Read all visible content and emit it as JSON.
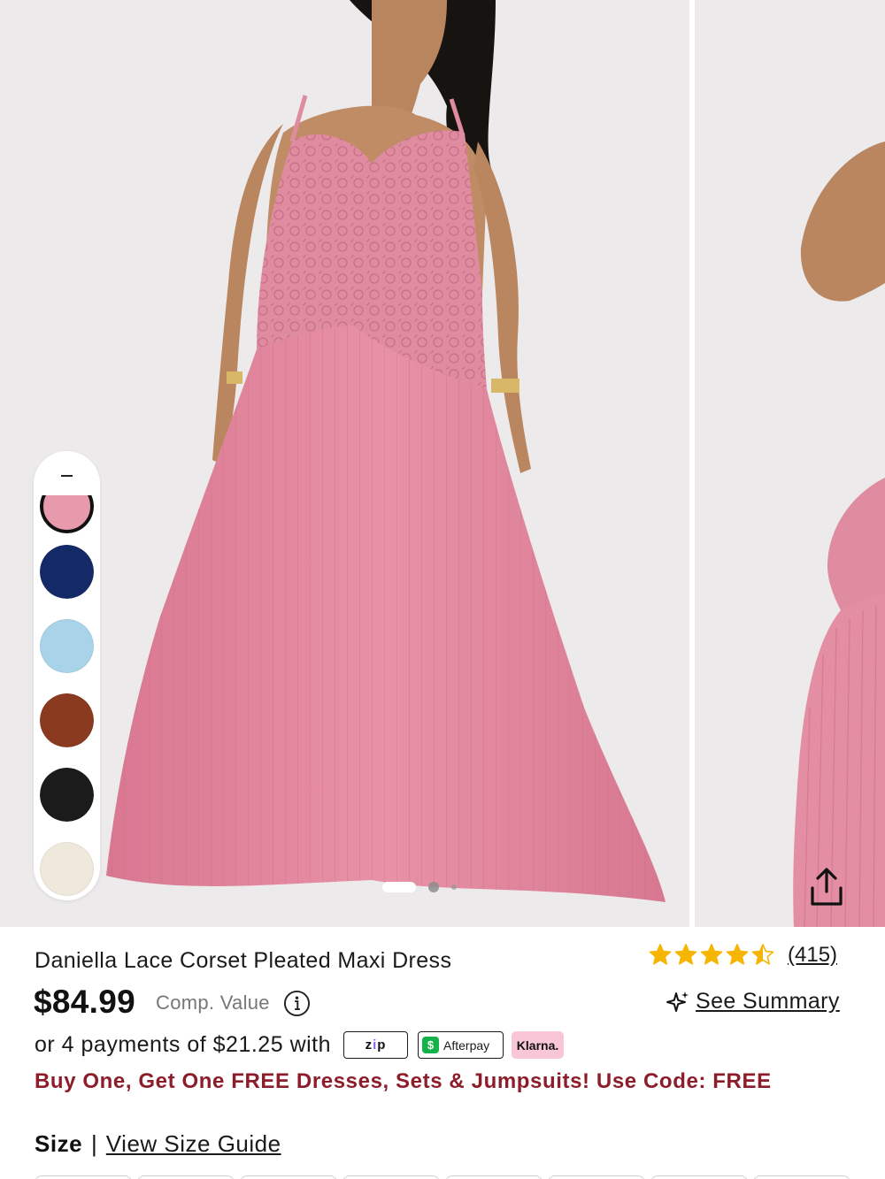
{
  "gallery": {
    "swatches": [
      {
        "name": "pink-lace-swatch",
        "color": "#e79aab",
        "selected": true
      },
      {
        "name": "navy-lace-swatch",
        "color": "#142a66"
      },
      {
        "name": "light-blue-lace-swatch",
        "color": "#a9d3e8"
      },
      {
        "name": "rust-lace-swatch",
        "color": "#8a3a1e"
      },
      {
        "name": "black-lace-swatch",
        "color": "#1b1b1b"
      },
      {
        "name": "ivory-lace-swatch",
        "color": "#efe9dc"
      }
    ],
    "page_count": 3,
    "active_page": 1
  },
  "product": {
    "title": "Daniella Lace Corset Pleated Maxi Dress",
    "rating": 4.5,
    "review_count": "(415)",
    "price": "$84.99",
    "comp_value_label": "Comp. Value",
    "see_summary_label": "See Summary",
    "installments_text": "or 4 payments of $21.25 with",
    "payment_providers": {
      "zip": "zip",
      "afterpay": "Afterpay",
      "klarna": "Klarna."
    },
    "promo": "Buy One, Get One FREE Dresses, Sets & Jumpsuits! Use Code: FREE",
    "size_label": "Size",
    "size_separator": "|",
    "size_guide_label": "View Size Guide"
  },
  "colors": {
    "star": "#f5b500",
    "promo_red": "#8c1d2a",
    "dress_pink": "#e58ba0"
  }
}
